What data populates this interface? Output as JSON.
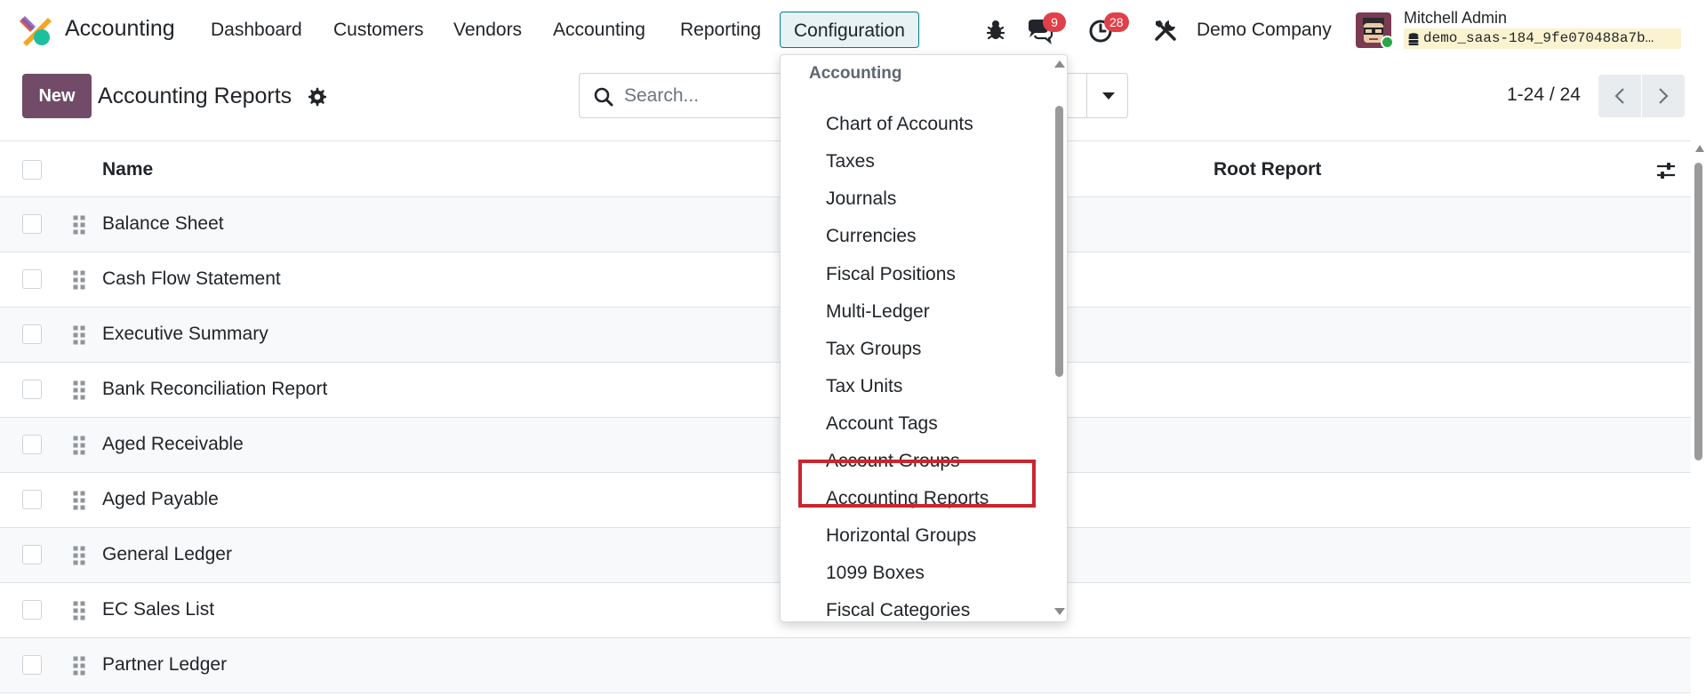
{
  "navbar": {
    "app_name": "Accounting",
    "menu": [
      "Dashboard",
      "Customers",
      "Vendors",
      "Accounting",
      "Reporting",
      "Configuration"
    ],
    "active_menu": "Configuration",
    "messages_count": "9",
    "activities_count": "28",
    "company": "Demo Company",
    "user_name": "Mitchell Admin",
    "database": "demo_saas-184_9fe070488a7b…"
  },
  "control_panel": {
    "new_label": "New",
    "title": "Accounting Reports",
    "search_placeholder": "Search...",
    "pager": "1-24 / 24"
  },
  "list": {
    "columns": {
      "name": "Name",
      "root_report": "Root Report"
    },
    "rows": [
      "Balance Sheet",
      "Cash Flow Statement",
      "Executive Summary",
      "Bank Reconciliation Report",
      "Aged Receivable",
      "Aged Payable",
      "General Ledger",
      "EC Sales List",
      "Partner Ledger"
    ]
  },
  "dropdown": {
    "section": "Accounting",
    "items": [
      "Chart of Accounts",
      "Taxes",
      "Journals",
      "Currencies",
      "Fiscal Positions",
      "Multi-Ledger",
      "Tax Groups",
      "Tax Units",
      "Account Tags",
      "Account Groups",
      "Accounting Reports",
      "Horizontal Groups",
      "1099 Boxes",
      "Fiscal Categories"
    ],
    "highlighted_item": "Accounting Reports"
  },
  "colors": {
    "brand": "#714b67",
    "active_menu_bg": "#e6f2f3",
    "active_menu_border": "#017e84",
    "badge": "#e0404a",
    "highlight_box": "#c9262f",
    "db_tag_bg": "#fbf3d0"
  },
  "icons": [
    "app-logo-icon",
    "bug-icon",
    "chat-icon",
    "clock-icon",
    "tools-icon",
    "database-icon",
    "gear-icon",
    "search-icon",
    "caret-down-icon",
    "chevron-left-icon",
    "chevron-right-icon",
    "sliders-icon",
    "drag-handle-icon"
  ]
}
